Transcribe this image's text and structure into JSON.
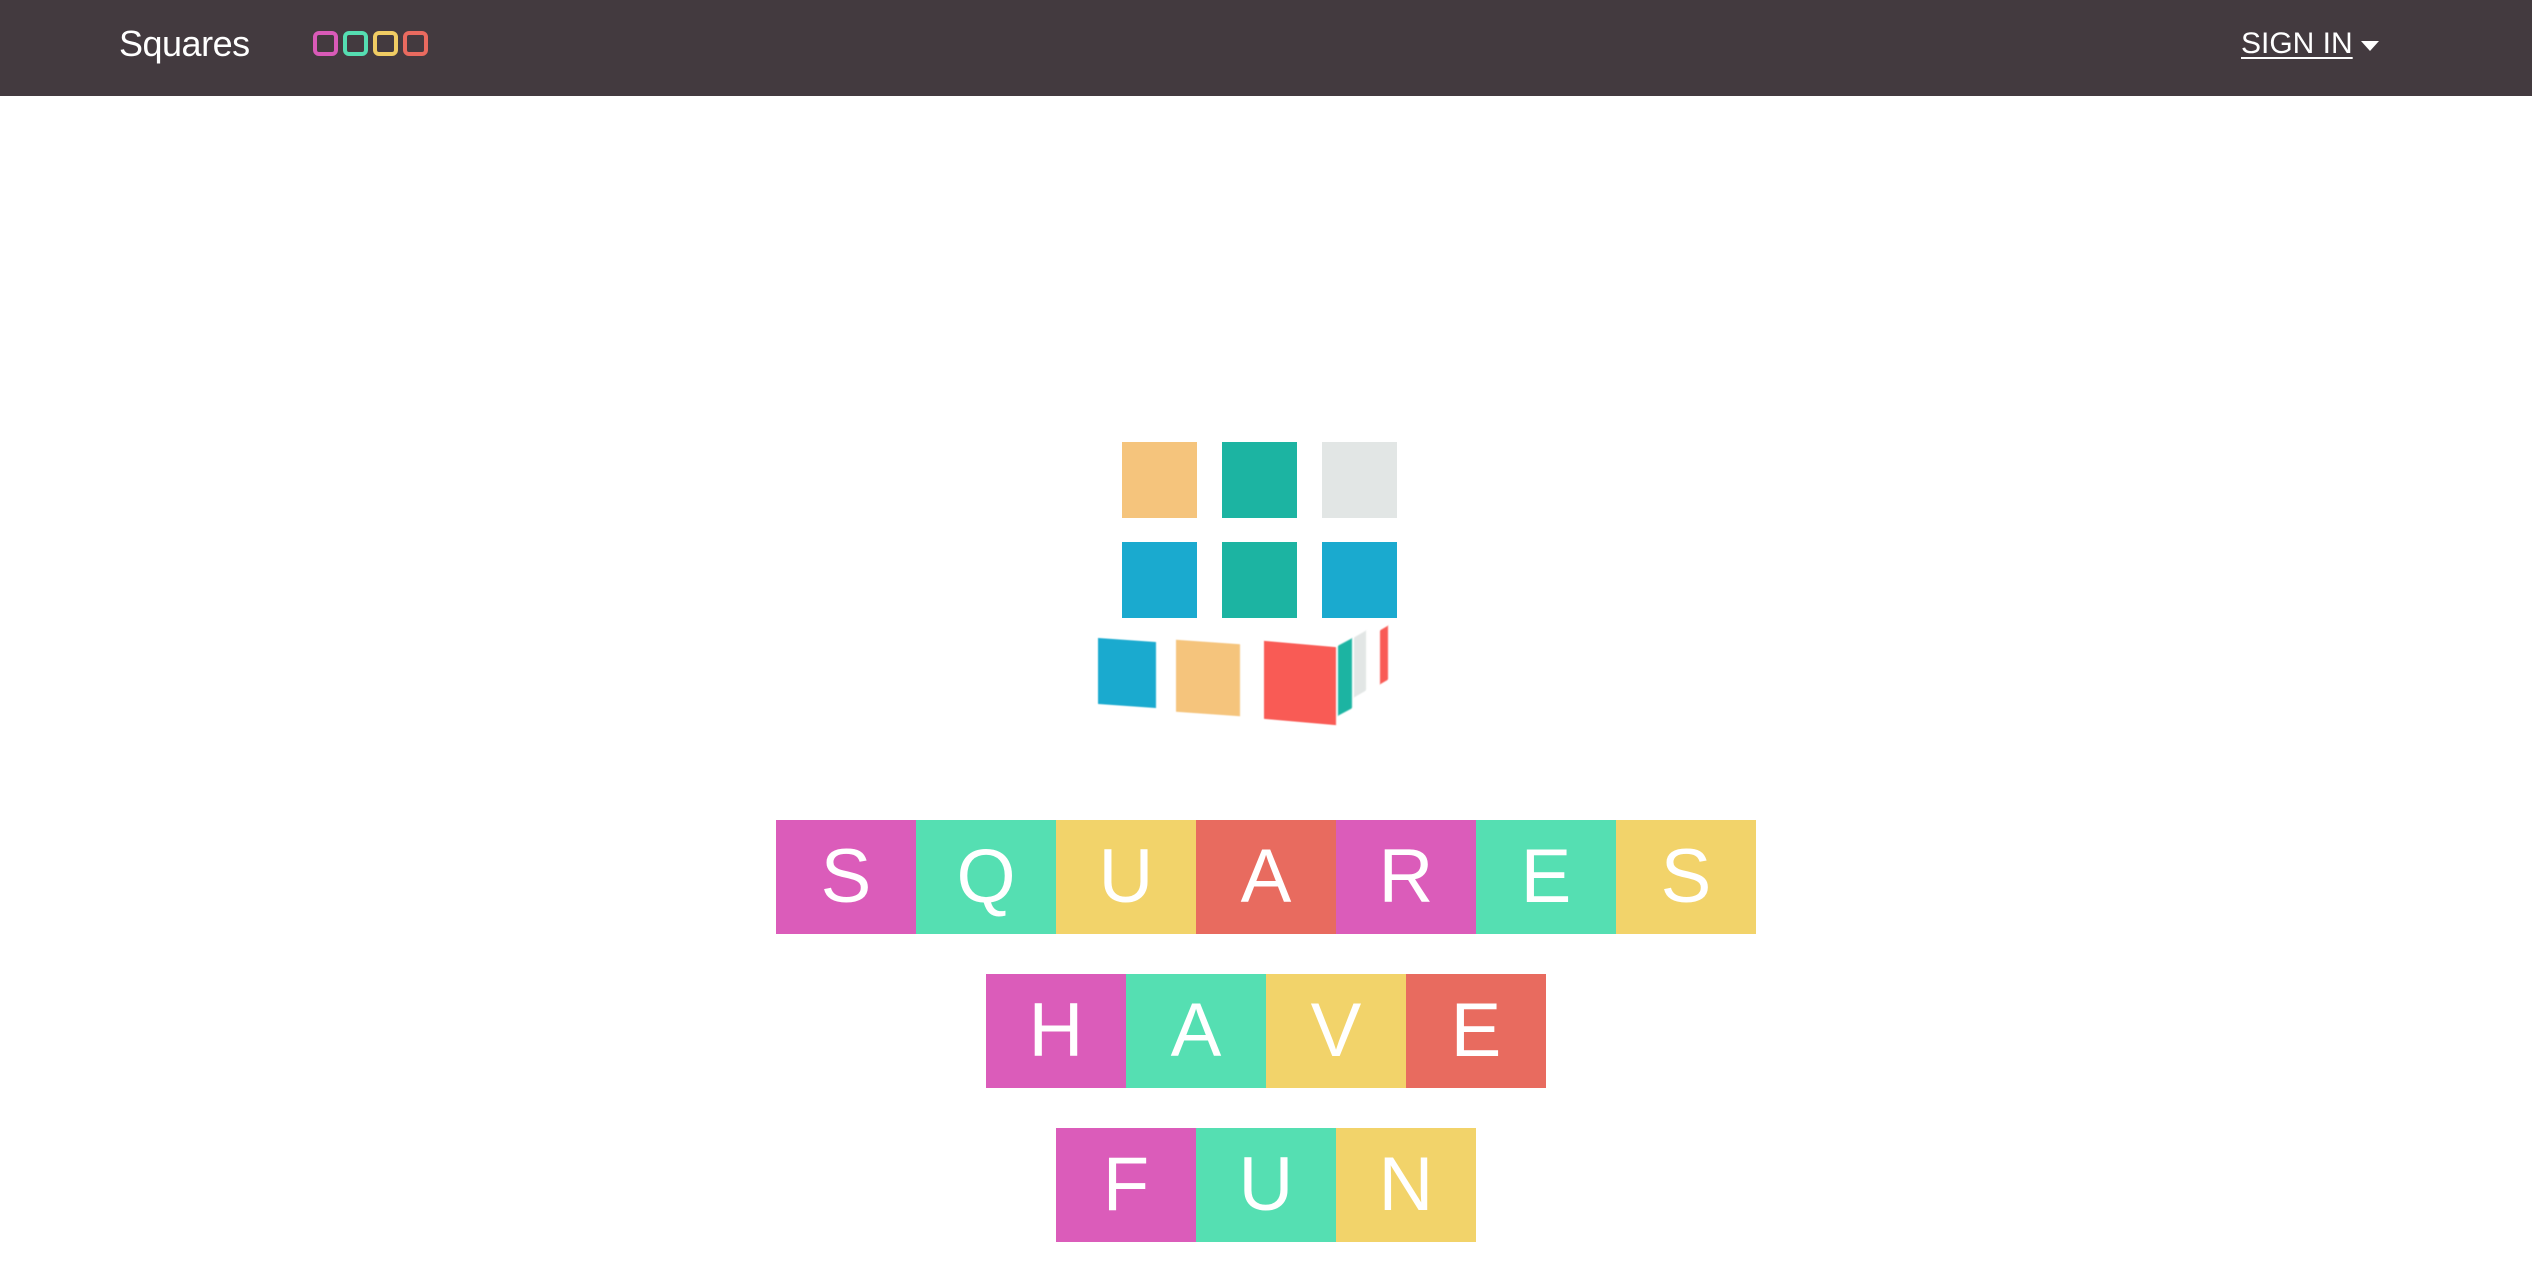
{
  "header": {
    "brand": "Squares",
    "brand_icon_colors": [
      "#d95ab8",
      "#55ddb1",
      "#f0cc63",
      "#e96a5f"
    ],
    "signin_label": "SIGN IN",
    "signin_icon": "caret-down-icon"
  },
  "colors": {
    "navbar": "#433a3f",
    "pink": "#db5cba",
    "teal": "#55dfb2",
    "yellow": "#f2d36a",
    "red": "#e86b5f"
  },
  "logo": {
    "icon": "cube-grid-icon",
    "cell_colors": [
      "#f5c47c",
      "#1cb4a2",
      "#e2e6e5",
      "#1aaacf",
      "#1cb4a2",
      "#1aaacf",
      "#1aaacf",
      "#f5c47c",
      "#f95b55"
    ]
  },
  "tiles": {
    "row1": [
      {
        "letter": "S",
        "color": "#db5cba"
      },
      {
        "letter": "Q",
        "color": "#55dfb2"
      },
      {
        "letter": "U",
        "color": "#f2d36a"
      },
      {
        "letter": "A",
        "color": "#e86b5f"
      },
      {
        "letter": "R",
        "color": "#db5cba"
      },
      {
        "letter": "E",
        "color": "#55dfb2"
      },
      {
        "letter": "S",
        "color": "#f2d36a"
      }
    ],
    "row2": [
      {
        "letter": "H",
        "color": "#db5cba"
      },
      {
        "letter": "A",
        "color": "#55dfb2"
      },
      {
        "letter": "V",
        "color": "#f2d36a"
      },
      {
        "letter": "E",
        "color": "#e86b5f"
      }
    ],
    "row3": [
      {
        "letter": "F",
        "color": "#db5cba"
      },
      {
        "letter": "U",
        "color": "#55dfb2"
      },
      {
        "letter": "N",
        "color": "#f2d36a"
      }
    ]
  }
}
